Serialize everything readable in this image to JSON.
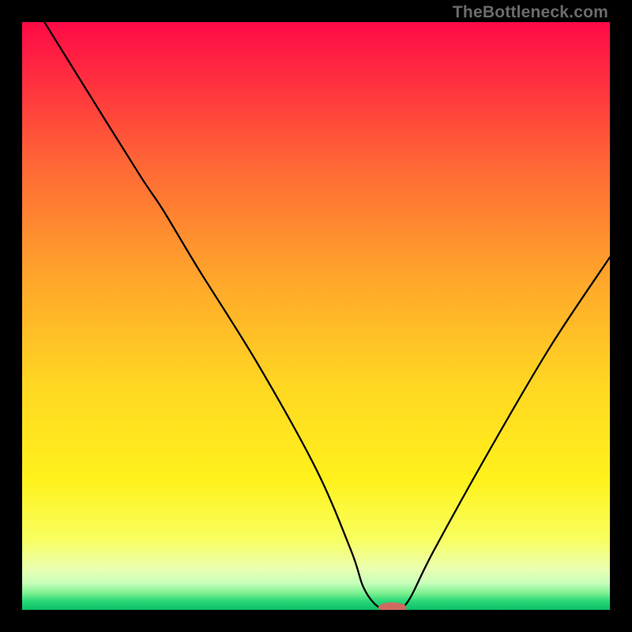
{
  "watermark": "TheBottleneck.com",
  "chart_data": {
    "type": "line",
    "title": "",
    "xlabel": "",
    "ylabel": "",
    "xlim": [
      0,
      100
    ],
    "ylim": [
      0,
      100
    ],
    "grid": false,
    "legend": false,
    "series": [
      {
        "name": "bottleneck-curve",
        "color": "#000000",
        "x": [
          3.8,
          10,
          20,
          24,
          30,
          40,
          50,
          56,
          58,
          60,
          62,
          64,
          66,
          70,
          80,
          90,
          100
        ],
        "values": [
          100,
          90,
          74,
          68,
          58,
          42,
          24,
          10,
          4,
          1,
          0,
          0,
          2,
          10,
          28,
          45,
          60
        ]
      }
    ],
    "marker": {
      "name": "optimal-marker",
      "color": "#cf6a61",
      "x": 63,
      "y": 0.4,
      "rx_pct": 2.4,
      "ry_pct": 0.9
    },
    "gradient_stops": [
      {
        "offset": 0.0,
        "color": "#ff0a47"
      },
      {
        "offset": 0.1,
        "color": "#ff2f3f"
      },
      {
        "offset": 0.25,
        "color": "#ff6a35"
      },
      {
        "offset": 0.45,
        "color": "#ffaa2a"
      },
      {
        "offset": 0.62,
        "color": "#ffd722"
      },
      {
        "offset": 0.78,
        "color": "#fff21c"
      },
      {
        "offset": 0.88,
        "color": "#f8ff60"
      },
      {
        "offset": 0.93,
        "color": "#eaffb0"
      },
      {
        "offset": 0.955,
        "color": "#c6ffba"
      },
      {
        "offset": 0.972,
        "color": "#7af090"
      },
      {
        "offset": 0.985,
        "color": "#29d877"
      },
      {
        "offset": 1.0,
        "color": "#0bbf67"
      }
    ]
  }
}
